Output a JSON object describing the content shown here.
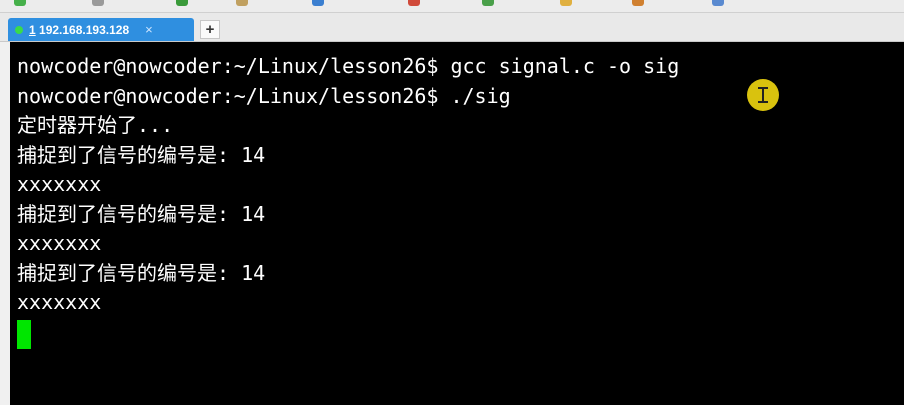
{
  "tab": {
    "number": "1",
    "host": "192.168.193.128",
    "close_glyph": "×"
  },
  "new_tab_glyph": "+",
  "terminal": {
    "lines": [
      "nowcoder@nowcoder:~/Linux/lesson26$ gcc signal.c -o sig",
      "nowcoder@nowcoder:~/Linux/lesson26$ ./sig",
      "定时器开始了...",
      "捕捉到了信号的编号是: 14",
      "xxxxxxx",
      "捕捉到了信号的编号是: 14",
      "xxxxxxx",
      "捕捉到了信号的编号是: 14",
      "xxxxxxx"
    ]
  },
  "colors": {
    "tab_active": "#2f8fe0",
    "terminal_bg": "#000000",
    "terminal_fg": "#ffffff",
    "cursor": "#00e600",
    "mouse_highlight": "#d9c20e"
  },
  "icons": {
    "tab_status": "status-dot-icon",
    "mouse_pointer": "text-cursor-icon"
  }
}
